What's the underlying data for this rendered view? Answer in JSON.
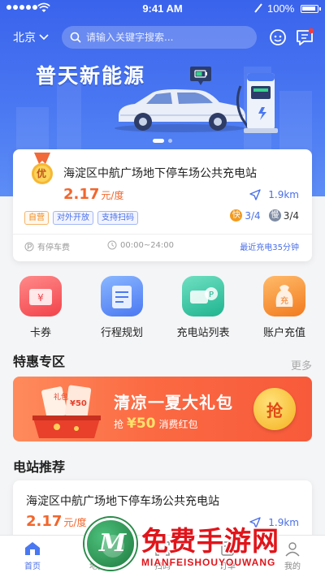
{
  "status_bar": {
    "time": "9:41 AM",
    "battery": "100%"
  },
  "header": {
    "city": "北京",
    "search_placeholder": "请输入关键字搜索..."
  },
  "banner": {
    "title": "普天新能源",
    "active_dot": 0,
    "dot_count": 2
  },
  "featured_station": {
    "badge": "优",
    "name": "海淀区中航广场地下停车场公共充电站",
    "price": "2.17",
    "price_unit": "元/度",
    "distance": "1.9km",
    "tags": [
      "自营",
      "对外开放",
      "支持扫码"
    ],
    "fast_label": "快",
    "fast_ports": "3/4",
    "slow_label": "慢",
    "slow_ports": "3/4",
    "parking": "有停车费",
    "hours": "00:00~24:00",
    "recent": "最近充电35分钟"
  },
  "quick_entries": [
    {
      "label": "卡券",
      "icon": "coupon-icon"
    },
    {
      "label": "行程规划",
      "icon": "route-plan-icon"
    },
    {
      "label": "充电站列表",
      "icon": "station-list-icon"
    },
    {
      "label": "账户充值",
      "icon": "recharge-bag-icon"
    }
  ],
  "deals": {
    "title": "特惠专区",
    "more": "更多",
    "promo_title": "清凉一夏大礼包",
    "promo_prefix": "抢",
    "promo_amount": "¥50",
    "promo_suffix": "消费红包",
    "grab_label": "抢",
    "ticket_text": "¥50",
    "ticket_small": "礼包"
  },
  "recommend": {
    "title": "电站推荐",
    "station_name": "海淀区中航广场地下停车场公共充电站",
    "price": "2.17",
    "price_unit": "元/度",
    "distance": "1.9km"
  },
  "tabbar": [
    {
      "label": "首页",
      "active": true
    },
    {
      "label": "地图",
      "active": false
    },
    {
      "label": "扫码",
      "active": false
    },
    {
      "label": "订单",
      "active": false
    },
    {
      "label": "我的",
      "active": false
    }
  ],
  "watermark": {
    "title": "免费手游网",
    "subtitle": "MIANFEISHOUYOUWANG",
    "logo_letter": "M"
  },
  "colors": {
    "primary": "#4a78f2",
    "price": "#f2662c",
    "promo": "#fb6a43",
    "link": "#4a6fe8"
  }
}
